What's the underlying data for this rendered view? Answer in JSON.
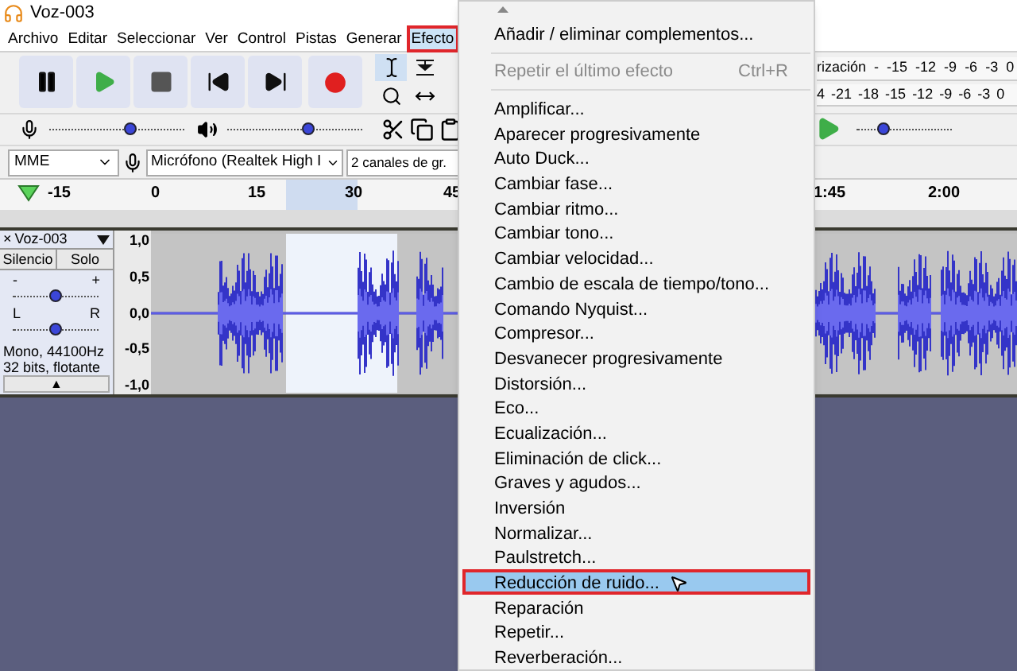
{
  "window": {
    "title": "Voz-003"
  },
  "menubar": [
    {
      "label": "Archivo",
      "selected": false
    },
    {
      "label": "Editar",
      "selected": false
    },
    {
      "label": "Seleccionar",
      "selected": false
    },
    {
      "label": "Ver",
      "selected": false
    },
    {
      "label": "Control",
      "selected": false
    },
    {
      "label": "Pistas",
      "selected": false
    },
    {
      "label": "Generar",
      "selected": false
    },
    {
      "label": "Efecto",
      "selected": true
    }
  ],
  "mixer": {
    "recording_volume": {
      "level": 0.6
    },
    "playback_volume": {
      "level": 0.6
    }
  },
  "meters": {
    "recording": {
      "label": "rización",
      "ticks": [
        "-",
        "-15",
        "-12",
        "-9",
        "-6",
        "-3",
        "0"
      ]
    },
    "playback": {
      "ticks": [
        "4",
        "-21",
        "-18",
        "-15",
        "-12",
        "-9",
        "-6",
        "-3",
        "0"
      ]
    },
    "play_at_speed": {
      "level": 0.28
    }
  },
  "device_bar": {
    "host": "MME",
    "input": "Micrófono (Realtek High I",
    "channels": "2 canales de gr."
  },
  "ruler": {
    "labels": [
      "-15",
      "0",
      "15",
      "30",
      "45",
      "1:45",
      "2:00"
    ]
  },
  "track": {
    "close": "×",
    "name": "Voz-003",
    "mute": "Silencio",
    "solo": "Solo",
    "gain": {
      "minus": "-",
      "plus": "+",
      "level": 0.5
    },
    "pan": {
      "left": "L",
      "right": "R",
      "level": 0.5
    },
    "format": "Mono, 44100Hz",
    "bits": "32 bits, flotante",
    "collapse": "▲",
    "scale": [
      "1,0",
      "0,5",
      "0,0",
      "-0,5",
      "-1,0"
    ]
  },
  "effect_menu": {
    "top": {
      "label": "Añadir / eliminar complementos...",
      "disabled": false
    },
    "repeat": {
      "label": "Repetir el último efecto",
      "shortcut": "Ctrl+R",
      "disabled": true
    },
    "items": [
      {
        "label": "Amplificar...",
        "selected": false
      },
      {
        "label": "Aparecer progresivamente",
        "selected": false
      },
      {
        "label": "Auto Duck...",
        "selected": false
      },
      {
        "label": "Cambiar fase...",
        "selected": false
      },
      {
        "label": "Cambiar ritmo...",
        "selected": false
      },
      {
        "label": "Cambiar tono...",
        "selected": false
      },
      {
        "label": "Cambiar velocidad...",
        "selected": false
      },
      {
        "label": "Cambio de escala de tiempo/tono...",
        "selected": false
      },
      {
        "label": "Comando Nyquist...",
        "selected": false
      },
      {
        "label": "Compresor...",
        "selected": false
      },
      {
        "label": "Desvanecer progresivamente",
        "selected": false
      },
      {
        "label": "Distorsión...",
        "selected": false
      },
      {
        "label": "Eco...",
        "selected": false
      },
      {
        "label": "Ecualización...",
        "selected": false
      },
      {
        "label": "Eliminación de click...",
        "selected": false
      },
      {
        "label": "Graves y agudos...",
        "selected": false
      },
      {
        "label": "Inversión",
        "selected": false
      },
      {
        "label": "Normalizar...",
        "selected": false
      },
      {
        "label": "Paulstretch...",
        "selected": false
      },
      {
        "label": "Reducción de ruido...",
        "selected": true
      },
      {
        "label": "Reparación",
        "selected": false
      },
      {
        "label": "Repetir...",
        "selected": false
      },
      {
        "label": "Reverberación...",
        "selected": false
      }
    ]
  }
}
